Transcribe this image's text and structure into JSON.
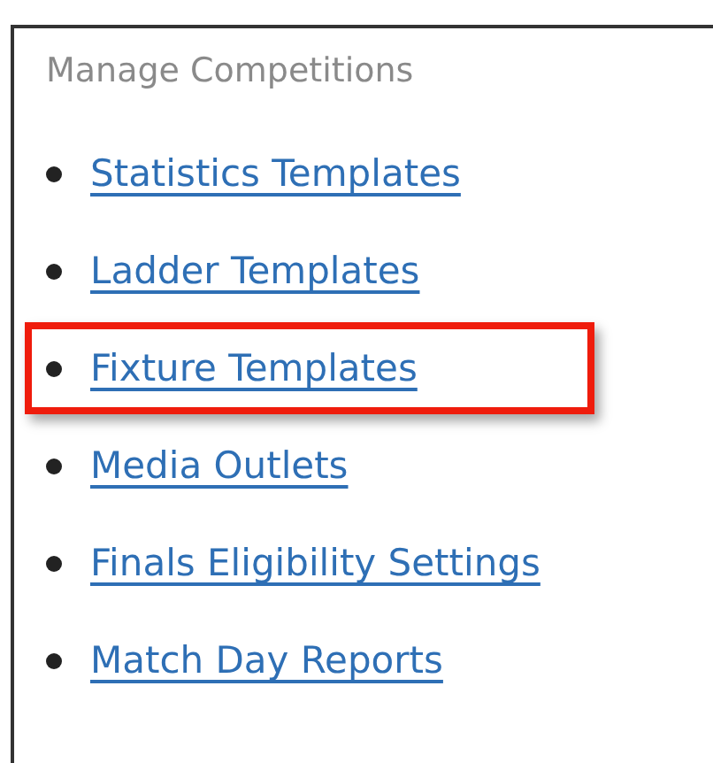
{
  "panel": {
    "title": "Manage Competitions",
    "links": [
      {
        "label": "Statistics Templates",
        "highlighted": false
      },
      {
        "label": "Ladder Templates",
        "highlighted": false
      },
      {
        "label": "Fixture Templates",
        "highlighted": true
      },
      {
        "label": "Media Outlets",
        "highlighted": false
      },
      {
        "label": "Finals Eligibility Settings",
        "highlighted": false
      },
      {
        "label": "Match Day Reports",
        "highlighted": false
      }
    ]
  }
}
